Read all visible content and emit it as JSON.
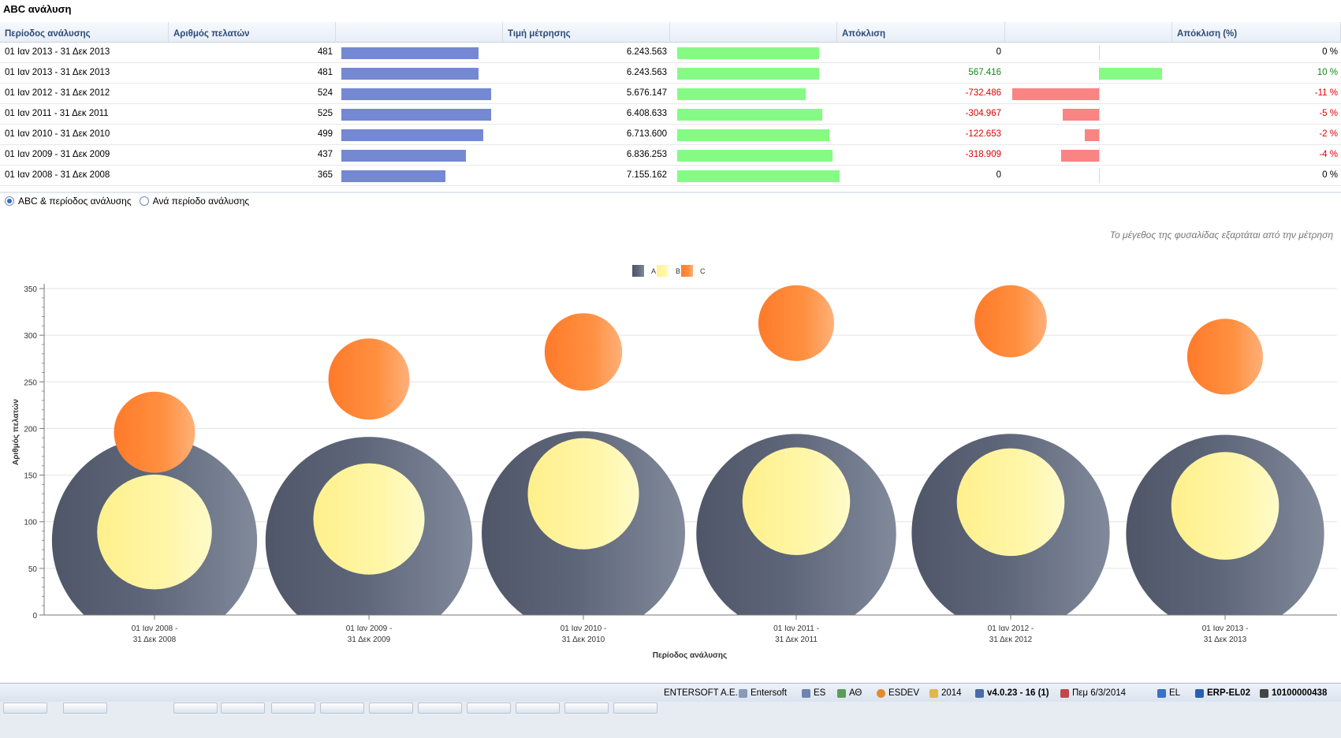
{
  "title": "ABC ανάλυση",
  "table": {
    "headers": [
      "Περίοδος ανάλυσης",
      "Αριθμός πελατών",
      "",
      "Τιμή μέτρησης",
      "",
      "Απόκλιση",
      "",
      "Απόκλιση (%)"
    ],
    "rows": [
      {
        "period": "01 Ιαν 2013 - 31 Δεκ 2013",
        "customers": "481",
        "cust_val": 481,
        "measure": "6.243.563",
        "meas_val": 6243563,
        "dev": "0",
        "dev_val": 0,
        "dev_pct": "0 %",
        "pct_val": 0
      },
      {
        "period": "01 Ιαν 2013 - 31 Δεκ 2013",
        "customers": "481",
        "cust_val": 481,
        "measure": "6.243.563",
        "meas_val": 6243563,
        "dev": "567.416",
        "dev_val": 567416,
        "dev_pct": "10 %",
        "pct_val": 10
      },
      {
        "period": "01 Ιαν 2012 - 31 Δεκ 2012",
        "customers": "524",
        "cust_val": 524,
        "measure": "5.676.147",
        "meas_val": 5676147,
        "dev": "-732.486",
        "dev_val": -732486,
        "dev_pct": "-11 %",
        "pct_val": -11
      },
      {
        "period": "01 Ιαν 2011 - 31 Δεκ 2011",
        "customers": "525",
        "cust_val": 525,
        "measure": "6.408.633",
        "meas_val": 6408633,
        "dev": "-304.967",
        "dev_val": -304967,
        "dev_pct": "-5 %",
        "pct_val": -5
      },
      {
        "period": "01 Ιαν 2010 - 31 Δεκ 2010",
        "customers": "499",
        "cust_val": 499,
        "measure": "6.713.600",
        "meas_val": 6713600,
        "dev": "-122.653",
        "dev_val": -122653,
        "dev_pct": "-2 %",
        "pct_val": -2
      },
      {
        "period": "01 Ιαν 2009 - 31 Δεκ 2009",
        "customers": "437",
        "cust_val": 437,
        "measure": "6.836.253",
        "meas_val": 6836253,
        "dev": "-318.909",
        "dev_val": -318909,
        "dev_pct": "-4 %",
        "pct_val": -4
      },
      {
        "period": "01 Ιαν 2008 - 31 Δεκ 2008",
        "customers": "365",
        "cust_val": 365,
        "measure": "7.155.162",
        "meas_val": 7155162,
        "dev": "0",
        "dev_val": 0,
        "dev_pct": "0 %",
        "pct_val": 0
      }
    ],
    "colors": {
      "customers_bar": "#7489d2",
      "measure_bar": "#85fb85",
      "dev_neg_bar": "#fa8383",
      "dev_pos_bar": "#85fb85",
      "neg_text": "#e00000",
      "pos_text": "#118811"
    }
  },
  "options": {
    "radio1": "ABC & περίοδος ανάλυσης",
    "radio2": "Ανά περίοδο ανάλυσης",
    "selected": "radio1"
  },
  "chart_note": "Το μέγεθος της φυσαλίδας εξαρτάται από την μέτρηση",
  "chart_data": {
    "type": "bubble",
    "ylabel": "Αριθμός πελατών",
    "xlabel": "Περίοδος ανάλυσης",
    "ylim": [
      0,
      350
    ],
    "yticks": [
      0,
      50,
      100,
      150,
      200,
      250,
      300,
      350
    ],
    "grid": true,
    "legend_position": "top-center",
    "categories": [
      {
        "line1": "01 Ιαν 2008 -",
        "line2": "31 Δεκ 2008"
      },
      {
        "line1": "01 Ιαν 2009 -",
        "line2": "31 Δεκ 2009"
      },
      {
        "line1": "01 Ιαν 2010 -",
        "line2": "31 Δεκ 2010"
      },
      {
        "line1": "01 Ιαν 2011 -",
        "line2": "31 Δεκ 2011"
      },
      {
        "line1": "01 Ιαν 2012 -",
        "line2": "31 Δεκ 2012"
      },
      {
        "line1": "01 Ιαν 2013 -",
        "line2": "31 Δεκ 2013"
      }
    ],
    "series": [
      {
        "name": "A",
        "color": "#555d70",
        "values": [
          80,
          80,
          88,
          87,
          88,
          87
        ],
        "size": [
          1.14,
          1.15,
          1.13,
          1.11,
          1.1,
          1.1
        ]
      },
      {
        "name": "B",
        "color": "#fff39b",
        "values": [
          89,
          103,
          130,
          122,
          121,
          117
        ],
        "size": [
          0.63,
          0.61,
          0.61,
          0.59,
          0.59,
          0.59
        ]
      },
      {
        "name": "C",
        "color": "#ff8a3c",
        "values": [
          196,
          253,
          282,
          313,
          315,
          277
        ],
        "size": [
          0.44,
          0.44,
          0.42,
          0.41,
          0.39,
          0.41
        ]
      }
    ]
  },
  "status": {
    "company": "ENTERSOFT A.E.",
    "db": "Entersoft",
    "lang_es": "ES",
    "branch": "ΑΘ",
    "user": "ESDEV",
    "year": "2014",
    "version": "v4.0.23 - 16 (1)",
    "date": "Πεμ 6/3/2014",
    "lang": "EL",
    "server": "ERP-EL02",
    "code": "10100000438"
  }
}
